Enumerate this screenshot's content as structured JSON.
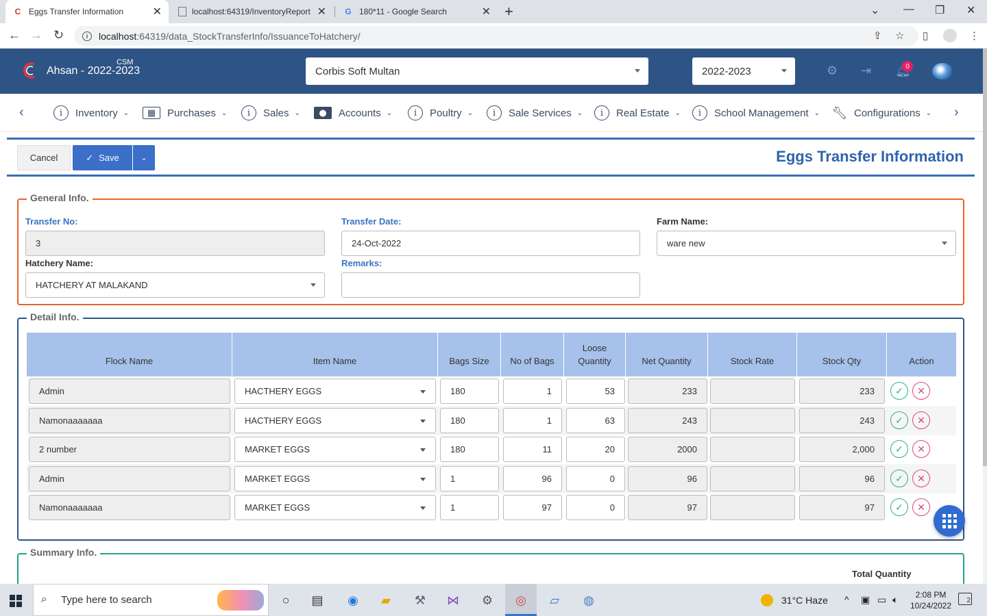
{
  "browser": {
    "tabs": [
      {
        "title": "Eggs Transfer Information",
        "favicon": "corbis-icon",
        "active": true
      },
      {
        "title": "localhost:64319/InventoryReport",
        "favicon": "doc-icon",
        "active": false
      },
      {
        "title": "180*11 - Google Search",
        "favicon": "google-icon",
        "active": false
      }
    ],
    "url_host": "localhost",
    "url_path": ":64319/data_StockTransferInfo/IssuanceToHatchery/"
  },
  "header": {
    "brand": "Ahsan - 2022-2023",
    "brand_sup": "CSM",
    "company": "Corbis Soft Multan",
    "year": "2022-2023",
    "notifications": "0"
  },
  "menu": [
    {
      "label": "Inventory",
      "icon": "info-icon"
    },
    {
      "label": "Purchases",
      "icon": "cash-register-icon"
    },
    {
      "label": "Sales",
      "icon": "info-icon"
    },
    {
      "label": "Accounts",
      "icon": "money-icon"
    },
    {
      "label": "Poultry",
      "icon": "info-icon"
    },
    {
      "label": "Sale Services",
      "icon": "info-icon"
    },
    {
      "label": "Real Estate",
      "icon": "info-icon"
    },
    {
      "label": "School Management",
      "icon": "info-icon"
    },
    {
      "label": "Configurations",
      "icon": "wrench-icon"
    }
  ],
  "toolbar": {
    "cancel": "Cancel",
    "save": "Save",
    "title": "Eggs Transfer Information"
  },
  "general": {
    "legend": "General Info.",
    "transfer_no_label": "Transfer No:",
    "transfer_no": "3",
    "transfer_date_label": "Transfer Date:",
    "transfer_date": "24-Oct-2022",
    "farm_name_label": "Farm Name:",
    "farm_name": "ware new",
    "hatchery_label": "Hatchery Name:",
    "hatchery": "HATCHERY AT MALAKAND",
    "remarks_label": "Remarks:",
    "remarks": ""
  },
  "detail": {
    "legend": "Detail Info.",
    "columns": [
      "Flock Name",
      "Item Name",
      "Bags Size",
      "No of Bags",
      "Loose Quantity",
      "Net Quantity",
      "Stock Rate",
      "Stock Qty",
      "Action"
    ],
    "rows": [
      {
        "flock": "Admin",
        "item": "HACTHERY EGGS",
        "bags_size": "180",
        "no_of_bags": "1",
        "loose": "53",
        "net": "233",
        "rate": "",
        "stock_qty": "233"
      },
      {
        "flock": "Namonaaaaaaa",
        "item": "HACTHERY EGGS",
        "bags_size": "180",
        "no_of_bags": "1",
        "loose": "63",
        "net": "243",
        "rate": "",
        "stock_qty": "243"
      },
      {
        "flock": "2 number",
        "item": "MARKET EGGS",
        "bags_size": "180",
        "no_of_bags": "11",
        "loose": "20",
        "net": "2000",
        "rate": "",
        "stock_qty": "2,000"
      },
      {
        "flock": "Admin",
        "item": "MARKET EGGS",
        "bags_size": "1",
        "no_of_bags": "96",
        "loose": "0",
        "net": "96",
        "rate": "",
        "stock_qty": "96"
      },
      {
        "flock": "Namonaaaaaaa",
        "item": "MARKET EGGS",
        "bags_size": "1",
        "no_of_bags": "97",
        "loose": "0",
        "net": "97",
        "rate": "",
        "stock_qty": "97"
      }
    ]
  },
  "summary": {
    "legend": "Summary Info.",
    "total_quantity_label": "Total Quantity"
  },
  "taskbar": {
    "search_placeholder": "Type here to search",
    "weather": "31°C  Haze",
    "time": "2:08 PM",
    "date": "10/24/2022",
    "notif_count": "2"
  },
  "colors": {
    "header_bg": "#2e5486",
    "accent": "#3b6fc8",
    "general_border": "#e8622c",
    "detail_border": "#2e5486",
    "summary_border": "#22a28c",
    "grid_header": "#a6c1ea"
  }
}
